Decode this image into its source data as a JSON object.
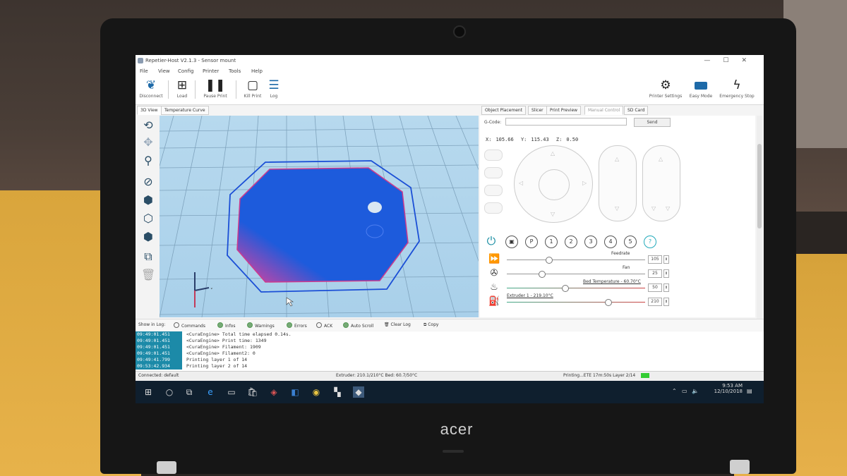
{
  "window": {
    "title": "Repetier-Host V2.1.3 - Sensor mount",
    "controls": [
      "—",
      "☐",
      "✕"
    ]
  },
  "menu": [
    "File",
    "View",
    "Config",
    "Printer",
    "Tools",
    "Help"
  ],
  "toolbar": {
    "left": [
      {
        "label": "Disconnect",
        "icon": "connection-leaf-icon"
      },
      {
        "label": "Load",
        "icon": "load-icon"
      },
      {
        "label": "Pause Print",
        "icon": "pause-icon"
      },
      {
        "label": "Kill Print",
        "icon": "kill-print-icon"
      },
      {
        "label": "Log",
        "icon": "log-icon"
      }
    ],
    "right": [
      {
        "label": "Printer Settings",
        "icon": "gear-icon"
      },
      {
        "label": "Easy Mode",
        "icon": "easy-mode-icon"
      },
      {
        "label": "Emergency Stop",
        "icon": "lightning-icon"
      }
    ]
  },
  "left_tabs": [
    "3D View",
    "Temperature Curve"
  ],
  "right_tabs": [
    "Object Placement",
    "Slicer",
    "Print Preview",
    "Manual Control",
    "SD Card"
  ],
  "manual_control": {
    "gcode_label": "G-Code:",
    "gcode_value": "",
    "send_label": "Send",
    "coords": {
      "x_label": "X:",
      "x": "105.66",
      "y_label": "Y:",
      "y": "115.43",
      "z_label": "Z:",
      "z": "0.50"
    },
    "number_buttons": [
      "P",
      "1",
      "2",
      "3",
      "4",
      "5",
      "?"
    ],
    "controls": [
      {
        "label": "Feedrate",
        "value": "105",
        "level": 0.3
      },
      {
        "label": "Fan",
        "value": "25",
        "level": 0.25
      },
      {
        "label": "Bed Temperature - 60.70°C",
        "value": "50",
        "level": 0.42
      },
      {
        "label": "Extruder 1 - 219.10°C",
        "value": "210",
        "level": 0.73
      }
    ]
  },
  "log_options": {
    "show_label": "Show in Log:",
    "items": [
      {
        "label": "Commands",
        "checked": false
      },
      {
        "label": "Infos",
        "checked": true
      },
      {
        "label": "Warnings",
        "checked": true
      },
      {
        "label": "Errors",
        "checked": true
      },
      {
        "label": "ACK",
        "checked": false
      },
      {
        "label": "Auto Scroll",
        "checked": true
      }
    ],
    "clear_label": "Clear Log",
    "copy_label": "Copy"
  },
  "log": [
    {
      "time": "09:49:01.451",
      "msg": "<CuraEngine> Total time elapsed  0.14s."
    },
    {
      "time": "09:49:01.451",
      "msg": "<CuraEngine> Print time: 1349"
    },
    {
      "time": "09:49:01.451",
      "msg": "<CuraEngine> Filament: 1909"
    },
    {
      "time": "09:49:01.451",
      "msg": "<CuraEngine> Filament2: 0"
    },
    {
      "time": "09:49:41.799",
      "msg": "Printing layer 1 of 14"
    },
    {
      "time": "09:53:42.934",
      "msg": "Printing layer 2 of 14"
    }
  ],
  "status": {
    "connected": "Connected: default",
    "temps": "Extruder: 210.1/210°C Bed: 60.7/50°C",
    "printing": "Printing...ETE 17m:50s Layer 2/14"
  },
  "taskbar": {
    "time": "9:53 AM",
    "date": "12/10/2018"
  },
  "brand": "acer"
}
